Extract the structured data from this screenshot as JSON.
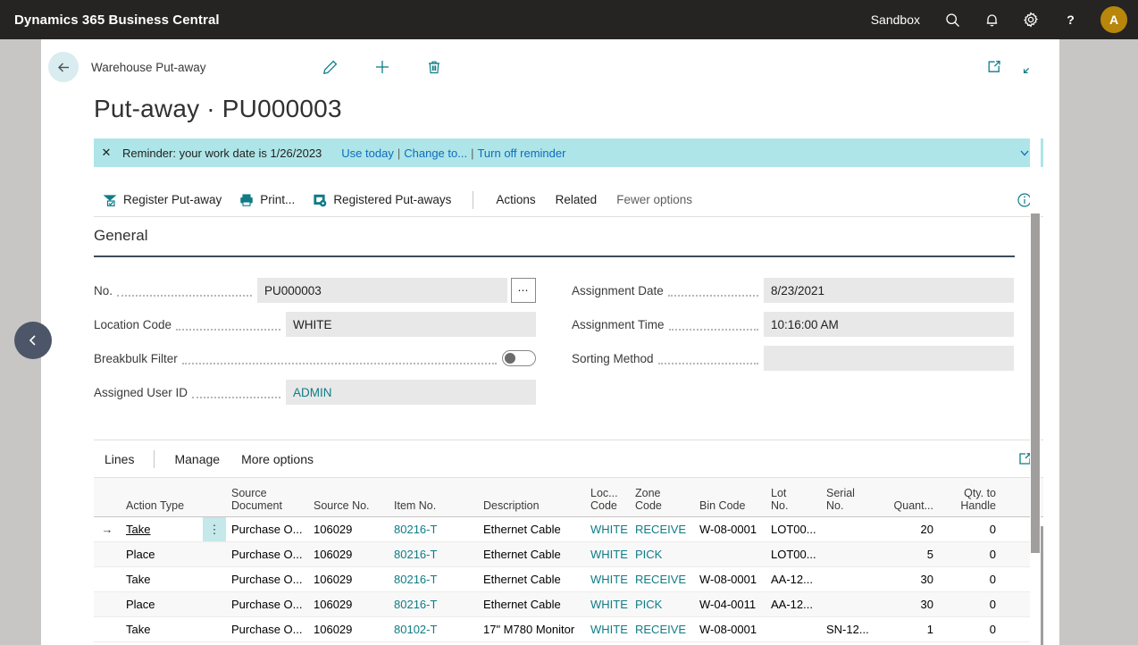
{
  "topbar": {
    "product_title": "Dynamics 365 Business Central",
    "environment": "Sandbox",
    "search_icon": "search-icon",
    "notification_icon": "bell-icon",
    "settings_icon": "gear-icon",
    "help_icon": "question-mark-icon",
    "avatar_initial": "A"
  },
  "header": {
    "back_icon": "back-arrow-icon",
    "breadcrumb": "Warehouse Put-away",
    "title": "Put-away · PU000003",
    "edit_icon": "pencil-icon",
    "new_icon": "plus-icon",
    "delete_icon": "trash-icon",
    "open_new_window_icon": "open-in-new-window-icon",
    "collapse_icon": "shrink-icon"
  },
  "notification": {
    "close_icon": "close-icon",
    "message": "Reminder: your work date is 1/26/2023",
    "links": [
      "Use today",
      "Change to...",
      "Turn off reminder"
    ],
    "separator": "|",
    "chevron_icon": "chevron-down-icon"
  },
  "commandbar": {
    "actions": [
      {
        "label": "Register Put-away",
        "icon": "register-putaway-icon"
      },
      {
        "label": "Print...",
        "icon": "printer-icon"
      },
      {
        "label": "Registered Put-aways",
        "icon": "registered-putaways-icon"
      }
    ],
    "menus": [
      "Actions",
      "Related",
      "Fewer options"
    ],
    "info_icon": "info-icon"
  },
  "general": {
    "section_title": "General",
    "left_fields": [
      {
        "label": "No.",
        "value": "PU000003",
        "has_lookup": true,
        "style": "text"
      },
      {
        "label": "Location Code",
        "value": "WHITE",
        "has_lookup": false,
        "style": "text"
      },
      {
        "label": "Breakbulk Filter",
        "value": "",
        "control": "toggle",
        "toggle_on": false
      },
      {
        "label": "Assigned User ID",
        "value": "ADMIN",
        "has_lookup": false,
        "style": "link"
      }
    ],
    "right_fields": [
      {
        "label": "Assignment Date",
        "value": "8/23/2021"
      },
      {
        "label": "Assignment Time",
        "value": "10:16:00 AM"
      },
      {
        "label": "Sorting Method",
        "value": ""
      }
    ]
  },
  "lines": {
    "tabs": [
      "Lines",
      "Manage",
      "More options"
    ],
    "expand_icon": "open-in-excel-icon",
    "columns": [
      "Action Type",
      "Source\nDocument",
      "Source No.",
      "Item No.",
      "Description",
      "Loc...\nCode",
      "Zone\nCode",
      "Bin Code",
      "Lot\nNo.",
      "Serial\nNo.",
      "Quant...",
      "Qty. to\nHandle"
    ],
    "rows": [
      {
        "selected": true,
        "action_type": "Take",
        "source_document": "Purchase O...",
        "source_no": "106029",
        "item_no": "80216-T",
        "description": "Ethernet Cable",
        "location_code": "WHITE",
        "zone_code": "RECEIVE",
        "bin_code": "W-08-0001",
        "lot_no": "LOT00...",
        "serial_no": "",
        "quantity": "20",
        "qty_to_handle": "0"
      },
      {
        "selected": false,
        "action_type": "Place",
        "source_document": "Purchase O...",
        "source_no": "106029",
        "item_no": "80216-T",
        "description": "Ethernet Cable",
        "location_code": "WHITE",
        "zone_code": "PICK",
        "bin_code": "",
        "lot_no": "LOT00...",
        "serial_no": "",
        "quantity": "5",
        "qty_to_handle": "0"
      },
      {
        "selected": false,
        "action_type": "Take",
        "source_document": "Purchase O...",
        "source_no": "106029",
        "item_no": "80216-T",
        "description": "Ethernet Cable",
        "location_code": "WHITE",
        "zone_code": "RECEIVE",
        "bin_code": "W-08-0001",
        "lot_no": "AA-12...",
        "serial_no": "",
        "quantity": "30",
        "qty_to_handle": "0"
      },
      {
        "selected": false,
        "action_type": "Place",
        "source_document": "Purchase O...",
        "source_no": "106029",
        "item_no": "80216-T",
        "description": "Ethernet Cable",
        "location_code": "WHITE",
        "zone_code": "PICK",
        "bin_code": "W-04-0011",
        "lot_no": "AA-12...",
        "serial_no": "",
        "quantity": "30",
        "qty_to_handle": "0"
      },
      {
        "selected": false,
        "action_type": "Take",
        "source_document": "Purchase O...",
        "source_no": "106029",
        "item_no": "80102-T",
        "description": "17\" M780 Monitor",
        "location_code": "WHITE",
        "zone_code": "RECEIVE",
        "bin_code": "W-08-0001",
        "lot_no": "",
        "serial_no": "SN-12...",
        "quantity": "1",
        "qty_to_handle": "0"
      }
    ]
  },
  "nav": {
    "collapse_icon": "chevron-left-icon"
  },
  "colors": {
    "topbar_bg": "#252423",
    "accent_teal": "#0f7c86",
    "notification_bg": "#aee5e8",
    "link_blue": "#0f6cbd",
    "avatar_bg": "#b8860b",
    "field_bg": "#e8e8e8",
    "page_bg": "#ffffff",
    "surround_bg": "#c8c6c4"
  }
}
